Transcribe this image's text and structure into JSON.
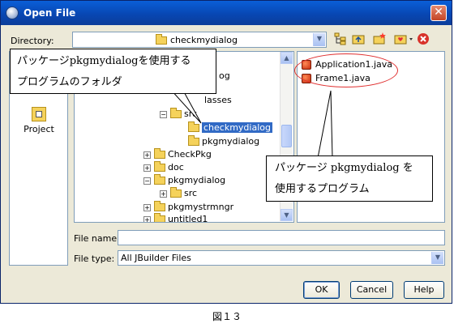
{
  "window": {
    "title": "Open File"
  },
  "directory": {
    "label": "Directory:",
    "value": "checkmydialog"
  },
  "sidebar": {
    "project_label": "Project"
  },
  "tree": {
    "items": [
      {
        "label": "og"
      },
      {
        "label": "lasses"
      },
      {
        "label": "src"
      },
      {
        "label": "checkmydialog",
        "selected": true
      },
      {
        "label": "pkgmydialog"
      },
      {
        "label": "CheckPkg"
      },
      {
        "label": "doc"
      },
      {
        "label": "pkgmydialog"
      },
      {
        "label": "src"
      },
      {
        "label": "pkgmystrmngr"
      },
      {
        "label": "untitled1"
      }
    ]
  },
  "files": [
    {
      "label": "Application1.java"
    },
    {
      "label": "Frame1.java"
    }
  ],
  "file_name": {
    "label": "File name:",
    "value": ""
  },
  "file_type": {
    "label": "File type:",
    "value": "All JBuilder Files"
  },
  "buttons": {
    "ok": "OK",
    "cancel": "Cancel",
    "help": "Help"
  },
  "callouts": {
    "folder_line1": "パッケージpkgmydialogを使用する",
    "folder_line2": "プログラムのフォルダ",
    "program_line1": "パッケージ pkgmydialog を",
    "program_line2": "使用するプログラム"
  },
  "caption": "図１３"
}
